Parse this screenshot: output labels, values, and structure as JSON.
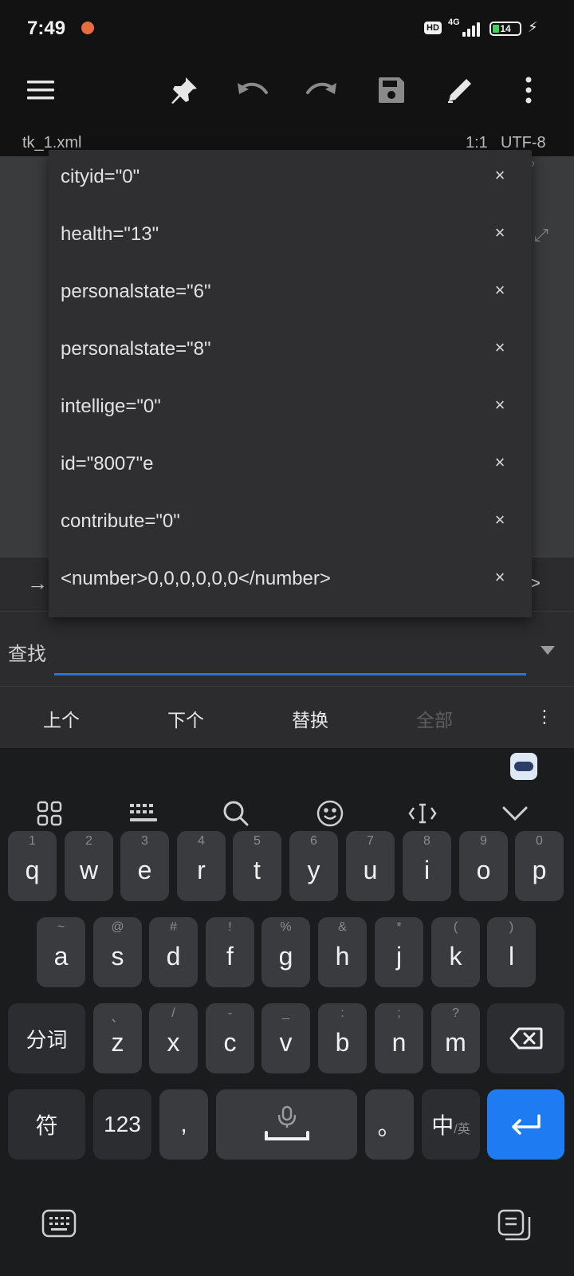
{
  "status_bar": {
    "time": "7:49",
    "hd": "HD",
    "network": "4G",
    "battery": "14"
  },
  "toolbar": {
    "icons": [
      "menu-icon",
      "pin-icon",
      "undo-icon",
      "redo-icon",
      "save-icon",
      "edit-icon",
      "more-vert-icon"
    ]
  },
  "file": {
    "name": "tk_1.xml",
    "cursor": "1:1",
    "encoding": "UTF-8"
  },
  "editor": {
    "glyph1": "?",
    "glyph2": ","
  },
  "history": {
    "items": [
      "cityid=\"0\"",
      "health=\"13\"",
      "personalstate=\"6\"",
      "personalstate=\"8\"",
      "intellige=\"0\"",
      "id=\"8007\"e",
      "contribute=\"0\"",
      "<number>0,0,0,0,0,0</number>"
    ],
    "close_symbol": "×"
  },
  "symbol_row": {
    "left": "→",
    "right": ">"
  },
  "find": {
    "label": "查找",
    "value": ""
  },
  "actions": {
    "prev": "上个",
    "next": "下个",
    "replace": "替换",
    "all": "全部",
    "more": "⋮"
  },
  "keyboard": {
    "row1": [
      {
        "sub": "1",
        "main": "q"
      },
      {
        "sub": "2",
        "main": "w"
      },
      {
        "sub": "3",
        "main": "e"
      },
      {
        "sub": "4",
        "main": "r"
      },
      {
        "sub": "5",
        "main": "t"
      },
      {
        "sub": "6",
        "main": "y"
      },
      {
        "sub": "7",
        "main": "u"
      },
      {
        "sub": "8",
        "main": "i"
      },
      {
        "sub": "9",
        "main": "o"
      },
      {
        "sub": "0",
        "main": "p"
      }
    ],
    "row2": [
      {
        "sub": "~",
        "main": "a"
      },
      {
        "sub": "@",
        "main": "s"
      },
      {
        "sub": "#",
        "main": "d"
      },
      {
        "sub": "!",
        "main": "f"
      },
      {
        "sub": "%",
        "main": "g"
      },
      {
        "sub": "&",
        "main": "h"
      },
      {
        "sub": "*",
        "main": "j"
      },
      {
        "sub": "(",
        "main": "k"
      },
      {
        "sub": ")",
        "main": "l"
      }
    ],
    "row3": [
      {
        "sub": "、",
        "main": "z"
      },
      {
        "sub": "/",
        "main": "x"
      },
      {
        "sub": "-",
        "main": "c"
      },
      {
        "sub": "_",
        "main": "v"
      },
      {
        "sub": ":",
        "main": "b"
      },
      {
        "sub": ";",
        "main": "n"
      },
      {
        "sub": "?",
        "main": "m"
      }
    ],
    "segment_key": "分词",
    "symbol_key": "符",
    "num_key": "123",
    "comma_key": ",",
    "period_key": "。",
    "lang_key_main": "中",
    "lang_key_sub": "/英"
  }
}
